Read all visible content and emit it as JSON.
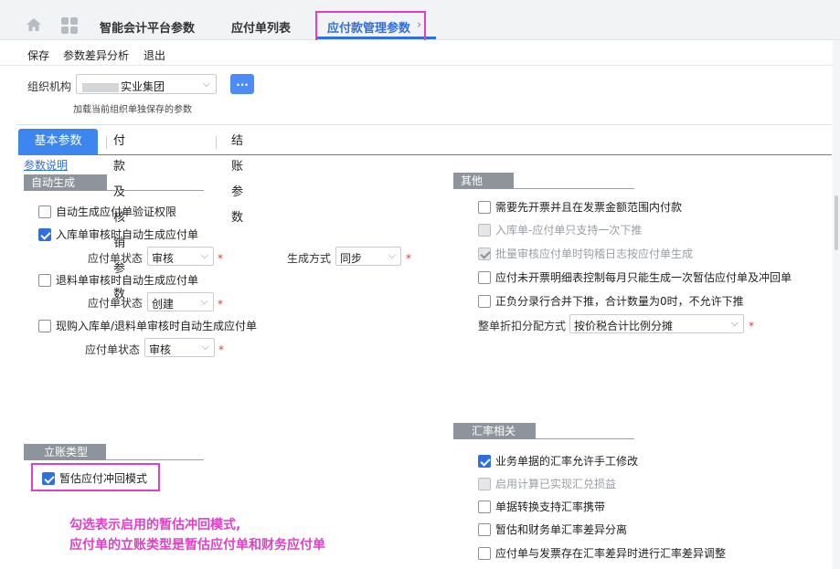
{
  "tabs": {
    "tab1": "智能会计平台参数",
    "tab2": "应付单列表",
    "tab3": "应付款管理参数",
    "close": "›"
  },
  "toolbar": {
    "save": "保存",
    "diff": "参数差异分析",
    "exit": "退出"
  },
  "org": {
    "label": "组织机构",
    "value": "实业集团",
    "button": "...",
    "hint": "加载当前组织单独保存的参数"
  },
  "subtabs": {
    "basic": "基本参数",
    "payment": "付款及核销参数",
    "closing": "结账参数"
  },
  "help_link": "参数说明",
  "auto": {
    "title": "自动生成",
    "item1": "自动生成应付单验证权限",
    "item2": "入库单审核时自动生成应付单",
    "item2_status_label": "应付单状态",
    "item2_status_value": "审核",
    "item2_method_label": "生成方式",
    "item2_method_value": "同步",
    "item3": "退料单审核时自动生成应付单",
    "item3_status_label": "应付单状态",
    "item3_status_value": "创建",
    "item4": "现购入库单/退料单审核时自动生成应付单",
    "item4_status_label": "应付单状态",
    "item4_status_value": "审核"
  },
  "other": {
    "title": "其他",
    "item1": "需要先开票并且在发票金额范围内付款",
    "item2": "入库单-应付单只支持一次下推",
    "item3": "批量审核应付单时钩稽日志按应付单生成",
    "item4": "应付未开票明细表控制每月只能生成一次暂估应付单及冲回单",
    "item5": "正负分录行合并下推，合计数量为0时，不允许下推",
    "discount_label": "整单折扣分配方式",
    "discount_value": "按价税合计比例分摊"
  },
  "account": {
    "title": "立账类型",
    "item1": "暂估应付冲回模式"
  },
  "rate": {
    "title": "汇率相关",
    "item1": "业务单据的汇率允许手工修改",
    "item2": "启用计算已实现汇兑损益",
    "item3": "单据转换支持汇率携带",
    "item4": "暂估和财务单汇率差异分离",
    "item5": "应付单与发票存在汇率差异时进行汇率差异调整"
  },
  "required_mark": "*",
  "annotation": {
    "line1": "勾选表示启用的暂估冲回模式,",
    "line2": "应付单的立账类型是暂估应付单和财务应付单"
  }
}
